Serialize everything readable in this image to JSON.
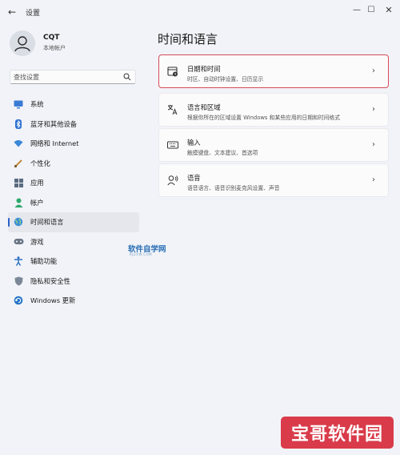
{
  "window": {
    "title": "设置",
    "back_glyph": "←",
    "controls": {
      "minimize": "—",
      "maximize": "☐",
      "close": "✕"
    }
  },
  "user": {
    "name": "CQT",
    "account_type": "本地帐户"
  },
  "search": {
    "placeholder": "查找设置"
  },
  "nav": {
    "items": [
      {
        "label": "系统",
        "icon": "monitor-icon",
        "active": false
      },
      {
        "label": "蓝牙和其他设备",
        "icon": "bluetooth-icon",
        "active": false
      },
      {
        "label": "网络和 Internet",
        "icon": "wifi-icon",
        "active": false
      },
      {
        "label": "个性化",
        "icon": "brush-icon",
        "active": false
      },
      {
        "label": "应用",
        "icon": "apps-icon",
        "active": false
      },
      {
        "label": "帐户",
        "icon": "person-icon",
        "active": false
      },
      {
        "label": "时间和语言",
        "icon": "globe-clock-icon",
        "active": true
      },
      {
        "label": "游戏",
        "icon": "gamepad-icon",
        "active": false
      },
      {
        "label": "辅助功能",
        "icon": "accessibility-icon",
        "active": false
      },
      {
        "label": "隐私和安全性",
        "icon": "shield-icon",
        "active": false
      },
      {
        "label": "Windows 更新",
        "icon": "update-icon",
        "active": false
      }
    ]
  },
  "main": {
    "title": "时间和语言",
    "cards": [
      {
        "title": "日期和时间",
        "desc": "时区、自动时钟设置、日历显示",
        "icon": "calendar-clock-icon",
        "highlight": true
      },
      {
        "title": "语言和区域",
        "desc": "根据你所在的区域设置 Windows 和某些应用的日期和时间格式",
        "icon": "language-icon",
        "highlight": false
      },
      {
        "title": "输入",
        "desc": "触摸键盘、文本建议、首选项",
        "icon": "keyboard-icon",
        "highlight": false
      },
      {
        "title": "语音",
        "desc": "语音语言、语音识别麦克风设置、声音",
        "icon": "speech-icon",
        "highlight": false
      }
    ],
    "chevron": "›"
  },
  "watermarks": {
    "middle": "软件自学网",
    "middle_sub": "RJZXW.COM",
    "logo": "宝哥软件园"
  },
  "colors": {
    "accent": "#2a61c7",
    "highlight_border": "#d74b59",
    "logo_bg": "#d93b4a"
  }
}
